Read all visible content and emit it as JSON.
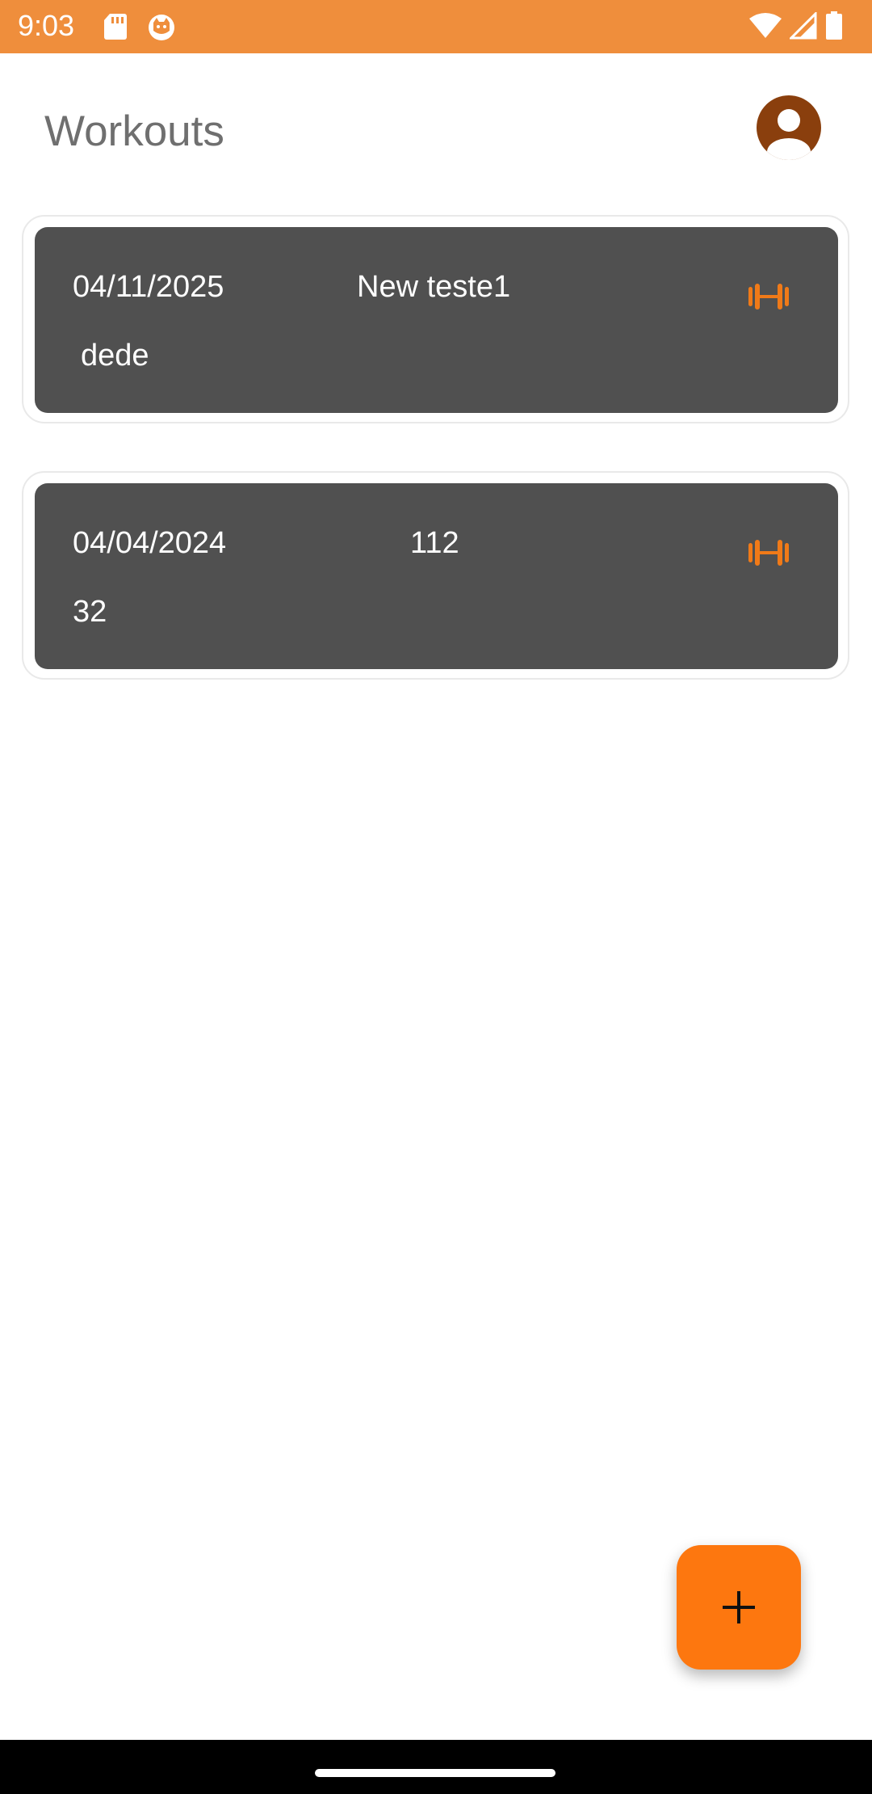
{
  "status_bar": {
    "time": "9:03",
    "icons": [
      "sd-card-icon",
      "cat-face-icon",
      "wifi-icon",
      "signal-icon",
      "battery-icon"
    ],
    "background": "#ef8e3c"
  },
  "header": {
    "title": "Workouts",
    "avatar_icon": "account-circle-icon",
    "avatar_color": "#8a3f0d"
  },
  "workouts": [
    {
      "date": "04/11/2025",
      "name": "New teste1",
      "description": "dede",
      "icon": "dumbbell-icon"
    },
    {
      "date": "04/04/2024",
      "name": "112",
      "description": "32",
      "icon": "dumbbell-icon"
    }
  ],
  "fab": {
    "icon": "plus-icon",
    "color": "#fd770f"
  },
  "colors": {
    "card": "#505050",
    "accent": "#f07a18",
    "title_text": "#6f6f6f"
  }
}
